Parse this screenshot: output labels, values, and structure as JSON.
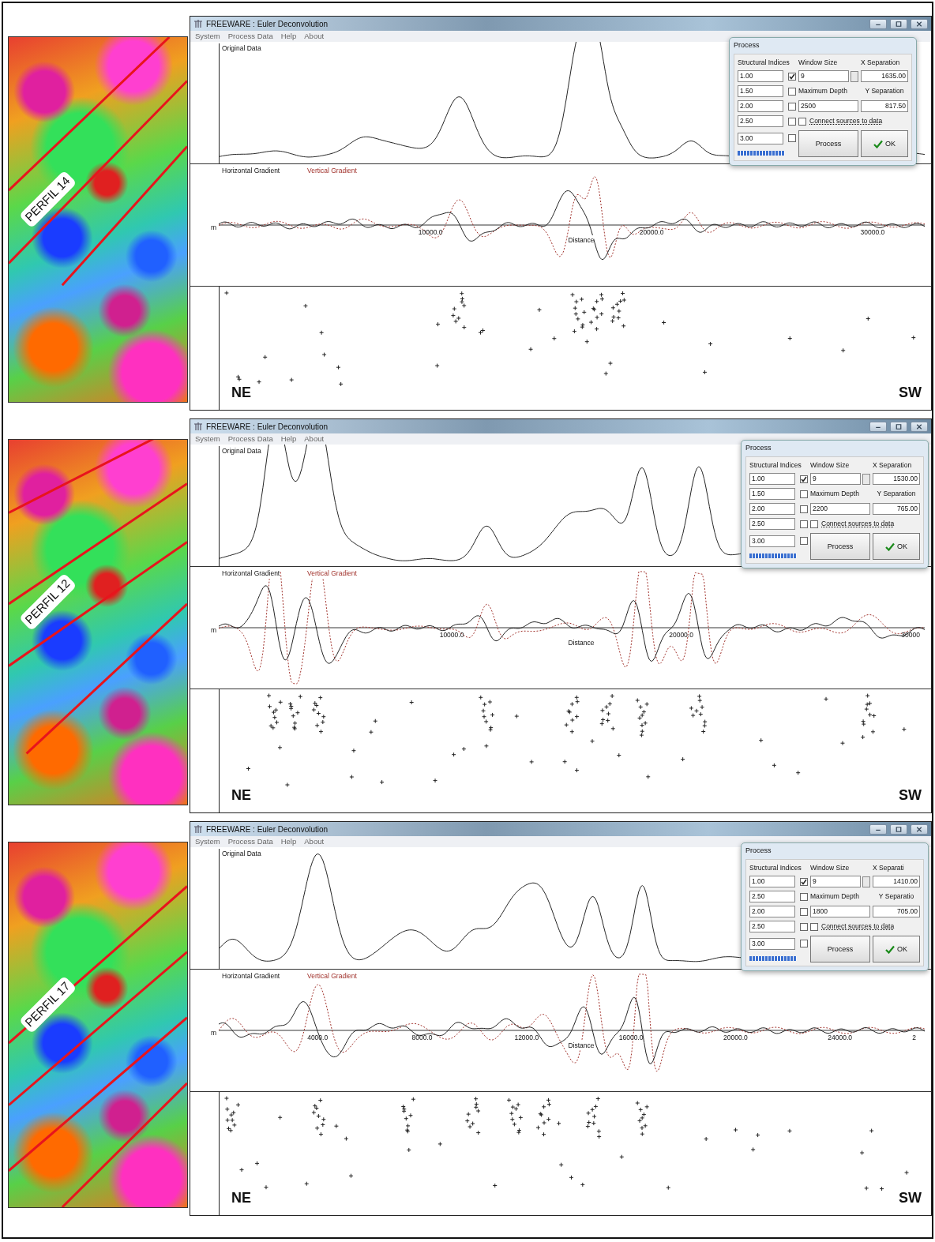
{
  "panels": [
    {
      "map": {
        "label": "PERFIL 14"
      },
      "window": {
        "title": "FREEWARE : Euler Deconvolution",
        "menu": [
          "System",
          "Process Data",
          "Help",
          "About"
        ]
      },
      "plots": {
        "original_title": "Original Data",
        "horizontal_label": "Horizontal Gradient",
        "vertical_label": "Vertical Gradient",
        "distance_label": "Distance",
        "y_unit": "m",
        "x_ticks": [
          "10000.0",
          "20000.0",
          "30000.0"
        ]
      },
      "dialog": {
        "title": "Process",
        "indices_heading": "Structural Indices",
        "window_size_heading": "Window Size",
        "x_sep_heading": "X Separation",
        "indices": [
          {
            "value": "1.00",
            "checked": true
          },
          {
            "value": "1.50",
            "checked": false
          },
          {
            "value": "2.00",
            "checked": false
          },
          {
            "value": "2.50",
            "checked": false
          },
          {
            "value": "3.00",
            "checked": false
          }
        ],
        "window_size": "9",
        "max_depth_label": "Maximum Depth",
        "max_depth": "2500",
        "y_sep_heading": "Y Separation",
        "x_separation": "1635.00",
        "y_separation": "817.50",
        "connect": {
          "label": "Connect sources to data",
          "checked": false
        },
        "progress": {
          "level": 1
        },
        "buttons": [
          {
            "label": "Process",
            "kind": "plain"
          },
          {
            "label": "OK",
            "kind": "ok"
          }
        ]
      },
      "directions": {
        "left": "NE",
        "right": "SW"
      }
    },
    {
      "map": {
        "label": "PERFIL 12"
      },
      "window": {
        "title": "FREEWARE : Euler Deconvolution",
        "menu": [
          "System",
          "Process Data",
          "Help",
          "About"
        ]
      },
      "plots": {
        "original_title": "Original Data",
        "horizontal_label": "Horizontal Gradient",
        "vertical_label": "Vertical Gradient",
        "distance_label": "Distance",
        "y_unit": "m",
        "x_ticks": [
          "10000.0",
          "20000.0",
          "30000"
        ]
      },
      "dialog": {
        "title": "Process",
        "indices_heading": "Structural Indices",
        "window_size_heading": "Window Size",
        "x_sep_heading": "X Separation",
        "indices": [
          {
            "value": "1.00",
            "checked": true
          },
          {
            "value": "1.50",
            "checked": false
          },
          {
            "value": "2.00",
            "checked": false
          },
          {
            "value": "2.50",
            "checked": false
          },
          {
            "value": "3.00",
            "checked": false
          }
        ],
        "window_size": "9",
        "max_depth_label": "Maximum Depth",
        "max_depth": "2200",
        "y_sep_heading": "Y Separation",
        "x_separation": "1530.00",
        "y_separation": "765.00",
        "connect": {
          "label": "Connect sources to data",
          "checked": false
        },
        "progress": {
          "level": 1
        },
        "buttons": [
          {
            "label": "Process",
            "kind": "plain"
          },
          {
            "label": "OK",
            "kind": "ok"
          }
        ]
      },
      "directions": {
        "left": "NE",
        "right": "SW"
      }
    },
    {
      "map": {
        "label": "PERFIL 17"
      },
      "window": {
        "title": "FREEWARE : Euler Deconvolution",
        "menu": [
          "System",
          "Process Data",
          "Help",
          "About"
        ]
      },
      "plots": {
        "original_title": "Original Data",
        "horizontal_label": "Horizontal Gradient",
        "vertical_label": "Vertical Gradient",
        "distance_label": "Distance",
        "y_unit": "m",
        "x_ticks": [
          "4000.0",
          "8000.0",
          "12000.0",
          "16000.0",
          "20000.0",
          "24000.0",
          "2"
        ]
      },
      "dialog": {
        "title": "Process",
        "indices_heading": "Structural Indices",
        "window_size_heading": "Window Size",
        "x_sep_heading": "X Separati",
        "indices": [
          {
            "value": "1.00",
            "checked": true
          },
          {
            "value": "2.50",
            "checked": false
          },
          {
            "value": "2.00",
            "checked": false
          },
          {
            "value": "2.50",
            "checked": false
          },
          {
            "value": "3.00",
            "checked": false
          }
        ],
        "window_size": "9",
        "max_depth_label": "Maximum Depth",
        "max_depth": "1800",
        "y_sep_heading": "Y Separatio",
        "x_separation": "1410.00",
        "y_separation": "705.00",
        "connect": {
          "label": "Connect sources to data",
          "checked": false
        },
        "progress": {
          "level": 1
        },
        "buttons": [
          {
            "label": "Process",
            "kind": "plain"
          },
          {
            "label": "OK",
            "kind": "ok"
          }
        ]
      },
      "directions": {
        "left": "NE",
        "right": "SW"
      }
    }
  ]
}
